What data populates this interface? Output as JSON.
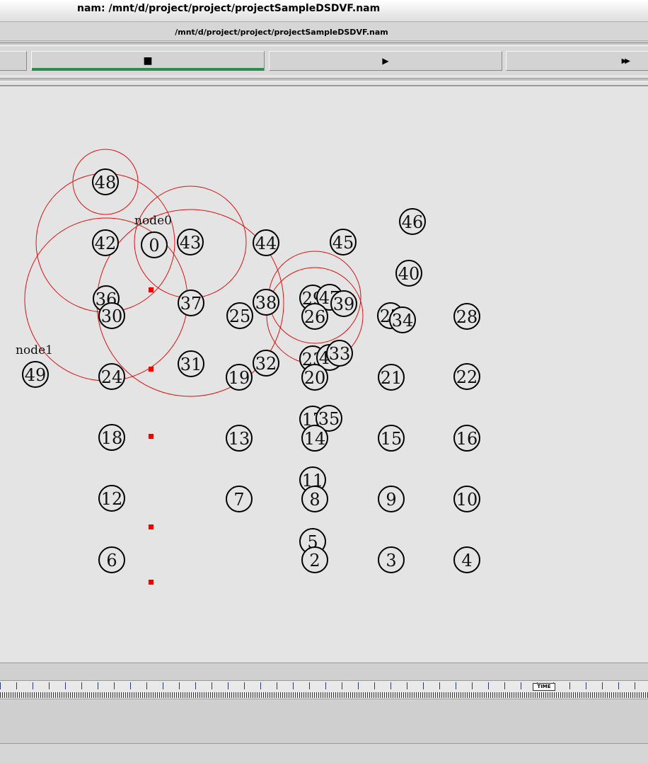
{
  "window": {
    "title": "nam: /mnt/d/project/project/projectSampleDSDVF.nam",
    "file_label": "/mnt/d/project/project/projectSampleDSDVF.nam"
  },
  "toolbar": {
    "stop_icon": "■",
    "play_icon": "▶",
    "fast_forward_icon": "▶▶"
  },
  "timeline": {
    "marker_label": "TIME"
  },
  "canvas": {
    "node_labels": [
      "node0",
      "node1"
    ],
    "ring_color": "#dd1111",
    "agent_color": "#ee0000",
    "nodes": [
      {
        "id": "48"
      },
      {
        "id": "46"
      },
      {
        "id": "42"
      },
      {
        "id": "0"
      },
      {
        "id": "43"
      },
      {
        "id": "44"
      },
      {
        "id": "45"
      },
      {
        "id": "40"
      },
      {
        "id": "36"
      },
      {
        "id": "30"
      },
      {
        "id": "37"
      },
      {
        "id": "25"
      },
      {
        "id": "38"
      },
      {
        "id": "29"
      },
      {
        "id": "47"
      },
      {
        "id": "39"
      },
      {
        "id": "26"
      },
      {
        "id": "27"
      },
      {
        "id": "34"
      },
      {
        "id": "28"
      },
      {
        "id": "49"
      },
      {
        "id": "24"
      },
      {
        "id": "31"
      },
      {
        "id": "19"
      },
      {
        "id": "32"
      },
      {
        "id": "23"
      },
      {
        "id": "41"
      },
      {
        "id": "33"
      },
      {
        "id": "20"
      },
      {
        "id": "21"
      },
      {
        "id": "22"
      },
      {
        "id": "18"
      },
      {
        "id": "13"
      },
      {
        "id": "17"
      },
      {
        "id": "35"
      },
      {
        "id": "14"
      },
      {
        "id": "15"
      },
      {
        "id": "16"
      },
      {
        "id": "12"
      },
      {
        "id": "7"
      },
      {
        "id": "11"
      },
      {
        "id": "8"
      },
      {
        "id": "9"
      },
      {
        "id": "10"
      },
      {
        "id": "5"
      },
      {
        "id": "6"
      },
      {
        "id": "2"
      },
      {
        "id": "3"
      },
      {
        "id": "4"
      }
    ]
  }
}
